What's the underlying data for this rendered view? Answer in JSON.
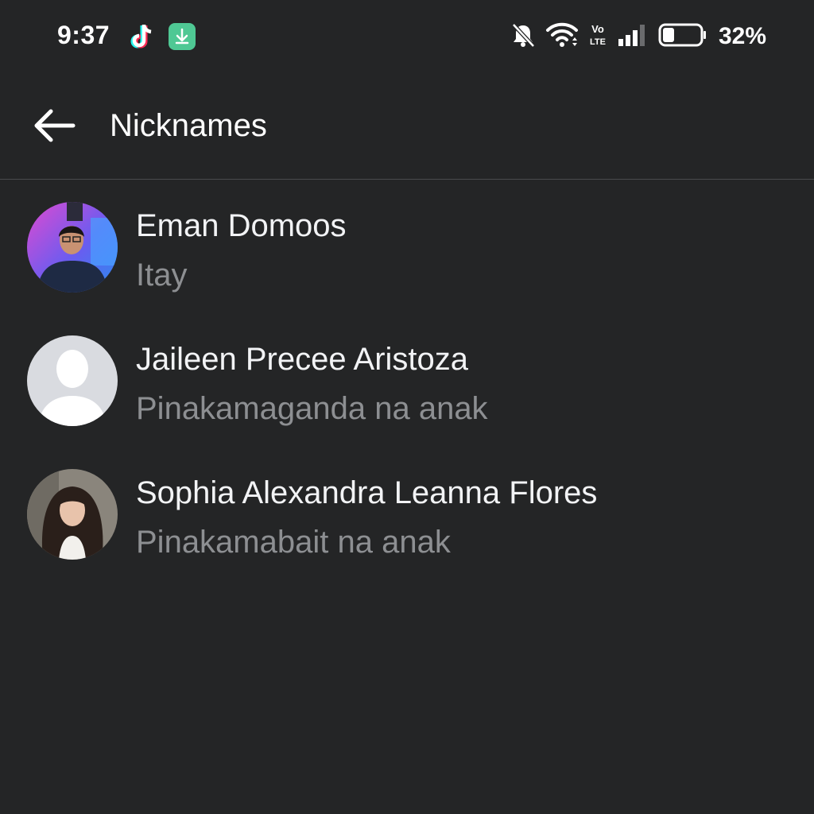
{
  "status_bar": {
    "time": "9:37",
    "battery_percent": "32%",
    "battery_level": 0.32,
    "icons": [
      "tiktok-icon",
      "download-icon",
      "bell-off-icon",
      "wifi-icon",
      "volte-icon",
      "signal-icon",
      "battery-icon"
    ]
  },
  "header": {
    "title": "Nicknames",
    "back_icon": "arrow-left-icon"
  },
  "contacts": [
    {
      "name": "Eman Domoos",
      "nickname": "Itay",
      "avatar": "photo-man-glasses"
    },
    {
      "name": "Jaileen Precee Aristoza",
      "nickname": "Pinakamaganda na anak",
      "avatar": "default-silhouette"
    },
    {
      "name": "Sophia Alexandra Leanna Flores",
      "nickname": "Pinakamabait na anak",
      "avatar": "photo-woman-long-hair"
    }
  ],
  "colors": {
    "background": "#242526",
    "primary_text": "#f2f3f5",
    "secondary_text": "#8d8f92",
    "divider": "#4a4b4d"
  }
}
